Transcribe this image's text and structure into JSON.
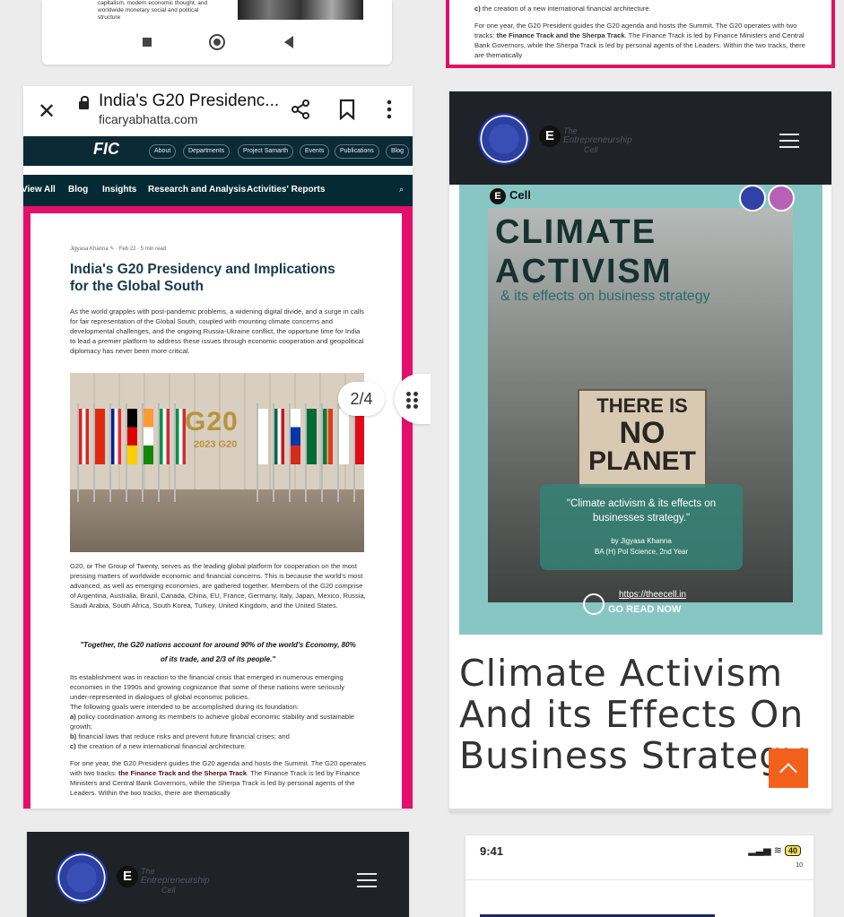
{
  "top_left": {
    "snippet_lines": [
      "capitalism, modern economic thought, and",
      "worldwide monetary social and political",
      "structure"
    ]
  },
  "top_right": {
    "lines": [
      "c) the creation of a new international financial architecture.",
      "For one year, the G20 President guides the G20 agenda and hosts the Summit. The G20 operates with two tracks: the Finance Track and the Sherpa Track. The Finance Track is led by Finance Ministers and Central Bank Governors, while the Sherpa Track is led by personal agents of the Leaders. Within the two tracks, there are thematically"
    ]
  },
  "browser": {
    "tab_title": "India's G20 Presidenc...",
    "domain": "ficaryabhatta.com"
  },
  "site": {
    "logo": "FIC",
    "nav": [
      "About",
      "Departments",
      "Project Samarth",
      "Events",
      "Publications",
      "Blog"
    ],
    "subnav": [
      "View All",
      "Blog",
      "Insights",
      "Research and Analysis",
      "Activities' Reports"
    ]
  },
  "article": {
    "meta": "Jigyasa Khanna ✎ · Feb 22 · 5 min read",
    "title": "India's G20 Presidency and Implications for the Global South",
    "intro": "As the world grapples with post-pandemic problems, a widening digital divide, and a surge in calls for fair representation of the Global South, coupled with mounting climate concerns and developmental challenges, and the ongoing Russia-Ukraine conflict, the opportune time for India to lead a premier platform to address these issues through economic cooperation and geopolitical diplomacy has never been more critical.",
    "image_sign": "G20",
    "image_subtitle": "2023 G20",
    "body1": "G20, or The Group of Twenty, serves as the leading global platform for cooperation on the most pressing matters of worldwide economic and financial concerns. This is because the world's most advanced, as well as emerging economies, are gathered together. Members of the G20 comprise of Argentina, Australia, Brazil, Canada, China, EU, France, Germany, Italy, Japan, Mexico, Russia, Saudi Arabia, South Africa, South Korea, Turkey, United Kingdom, and the United States.",
    "quote": "\"Together, the G20 nations account for around 90% of the world's Economy, 80% of its trade, and 2/3 of its people.\"",
    "body2_p1": "Its establishment was in reaction to the financial crisis that emerged in numerous emerging economies in the 1990s and growing cognizance that some of these nations were seriously under-represented in dialogues of global economic policies.",
    "body2_p1b": "The following goals were intended to be accomplished during its foundation:",
    "goal_a_label": "a)",
    "goal_a": "policy coordination among its members to achieve global economic stability and sustainable growth;",
    "goal_b_label": "b)",
    "goal_b": "financial laws that reduce risks and prevent future financial crises; and",
    "goal_c_label": "c)",
    "goal_c": "the creation of a new international financial architecture.",
    "body2_p2_start": "For one year, the G20 President guides the G20 agenda and hosts the Summit. The G20 operates with two tracks: ",
    "body2_p2_bold": "the Finance Track and the Sherpa Track",
    "body2_p2_end": ". The Finance Track is led by Finance Ministers and Central Bank Governors, while the Sherpa Track is led by personal agents of the Leaders. Within the two tracks, there are thematically"
  },
  "page_indicator": "2/4",
  "ecell": {
    "brand_line1": "The",
    "brand_line2": "Entrepreneurship",
    "brand_line3": "Cell",
    "e_letter": "E"
  },
  "poster": {
    "ecell_label": "Cell",
    "title_line1": "CLIMATE",
    "title_line2": "ACTIVISM",
    "subtitle": "& its effects on business strategy",
    "sign_l1": "THERE IS",
    "sign_l2": "NO",
    "sign_l3": "PLANET",
    "quote": "\"Climate activism & its effects on businesses strategy.\"",
    "author": "by Jigyasa Khanna",
    "author_course": "BA (H) Pol Science, 2nd Year",
    "url": "https://theecell.in",
    "cta": "GO READ NOW"
  },
  "right_article": {
    "title": "Climate Activism And its Effects On Business Strategy"
  },
  "status_bar": {
    "time": "9:41",
    "right": "40",
    "number": "10"
  },
  "colors": {
    "accent_pink": "#e01267",
    "site_header": "#0c2a35",
    "ecell_header": "#1f2227",
    "poster_bg": "#88c6c4",
    "scroll_button": "#f2611c"
  }
}
